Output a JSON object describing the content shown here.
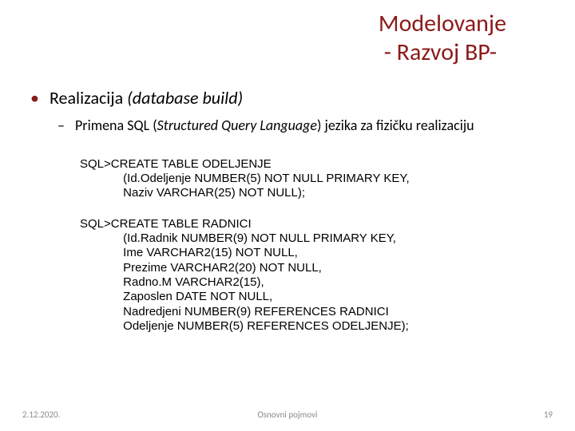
{
  "title": {
    "line1": "Modelovanje",
    "line2": " - Razvoj BP-"
  },
  "bullet": {
    "text_main": "Realizacija ",
    "text_paren": "(database build)"
  },
  "sub": {
    "prefix": "Primena SQL (",
    "italic": "Structured Query Language",
    "suffix": ") jezika za fizičku realizaciju"
  },
  "sql1": "SQL>CREATE TABLE ODELJENJE\n             (Id.Odeljenje NUMBER(5) NOT NULL PRIMARY KEY,\n             Naziv VARCHAR(25) NOT NULL);",
  "sql2": "SQL>CREATE TABLE RADNICI\n             (Id.Radnik NUMBER(9) NOT NULL PRIMARY KEY,\n             Ime VARCHAR2(15) NOT NULL,\n             Prezime VARCHAR2(20) NOT NULL,\n             Radno.M VARCHAR2(15),\n             Zaposlen DATE NOT NULL,\n             Nadredjeni NUMBER(9) REFERENCES RADNICI\n             Odeljenje NUMBER(5) REFERENCES ODELJENJE);",
  "footer": {
    "date": "2.12.2020.",
    "center": "Osnovni pojmovi",
    "page": "19"
  }
}
